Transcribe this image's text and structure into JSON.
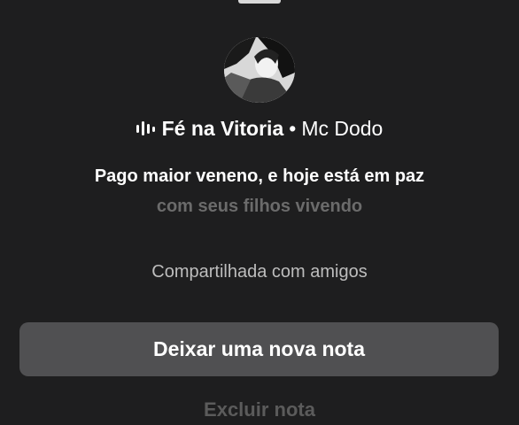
{
  "note": {
    "song_title": "Fé na Vitoria",
    "separator": "•",
    "artist": "Mc Dodo",
    "lyric_current": "Pago maior veneno, e hoje está em paz",
    "lyric_next": "com seus filhos vivendo",
    "visibility": "Compartilhada com amigos"
  },
  "actions": {
    "new_note_label": "Deixar uma nova nota",
    "delete_note_label": "Excluir nota"
  },
  "icons": {
    "music": "audio-bars-icon",
    "avatar": "profile-avatar"
  },
  "colors": {
    "background": "#1e1e1f",
    "button": "#505052",
    "text_primary": "#ffffff",
    "text_muted": "#6b6b6b",
    "text_secondary": "#bdbdbd"
  }
}
